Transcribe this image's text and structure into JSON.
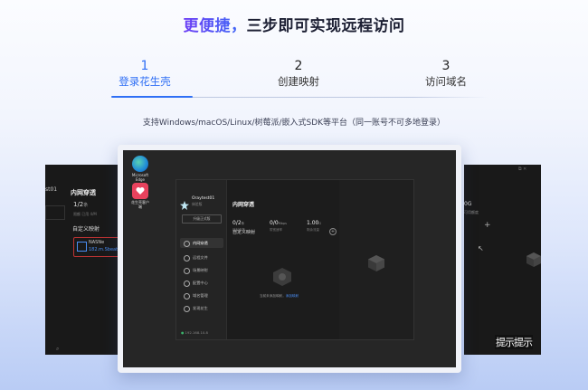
{
  "headline": {
    "highlight": "更便捷，",
    "rest": "三步即可实现远程访问"
  },
  "steps": [
    {
      "num": "1",
      "label": "登录花生壳",
      "active": true
    },
    {
      "num": "2",
      "label": "创建映射",
      "active": false
    },
    {
      "num": "3",
      "label": "访问域名",
      "active": false
    }
  ],
  "subtitle": "支持Windows/macOS/Linux/树莓派/嵌入式SDK等平台（同一账号不可多地登录）",
  "colors": {
    "accent": "#2f6ff5",
    "gradient_start": "#6b3df5",
    "gradient_end": "#3a6df6",
    "dark_bg": "#1e1e1e"
  },
  "left_screen": {
    "account_fragment": "st01",
    "panel_title": "内网穿透",
    "count": "1/2",
    "count_unit": "条",
    "small_note": "限额 已用 4/M",
    "section": "自定义映射",
    "nas_label": "NASNe",
    "nas_link": "182.m.Sbeat"
  },
  "right_screen": {
    "value_fragment": "0G",
    "value_sub": "可用额度",
    "plus": "+"
  },
  "desktop_icons": [
    {
      "name": "Microsoft Edge",
      "icon": "edge-icon",
      "color": "#1f8ad8"
    },
    {
      "name": "花生壳客户端",
      "icon": "peanut-icon",
      "color": "#e8425d"
    }
  ],
  "app": {
    "username": "Oraytest01",
    "user_sub": "体验版",
    "upgrade_btn": "升级正式版",
    "nav": [
      {
        "label": "内网穿透",
        "icon": "tunnel-icon",
        "active": true
      },
      {
        "label": "远程文件",
        "icon": "file-icon",
        "active": false
      },
      {
        "label": "场景映射",
        "icon": "scene-icon",
        "active": false
      },
      {
        "label": "配置中心",
        "icon": "config-icon",
        "active": false
      },
      {
        "label": "域名管理",
        "icon": "domain-icon",
        "active": false
      },
      {
        "label": "发现花生",
        "icon": "discover-icon",
        "active": false
      }
    ],
    "ip": "192.168.10.8",
    "panel_title": "内网穿透",
    "stats": [
      {
        "value": "0/2",
        "unit": "条",
        "label": "映射条数"
      },
      {
        "value": "0/0",
        "unit": "Mbps",
        "label": "带宽速率"
      },
      {
        "value": "1.00",
        "unit": "G",
        "label": "剩余流量"
      }
    ],
    "section": "自定义映射",
    "empty_text": "当前未添加映射，",
    "empty_link": "添加映射",
    "titlebar_icons": [
      "menu-icon",
      "minimize-icon",
      "close-icon"
    ]
  },
  "watermark": "提示提示"
}
